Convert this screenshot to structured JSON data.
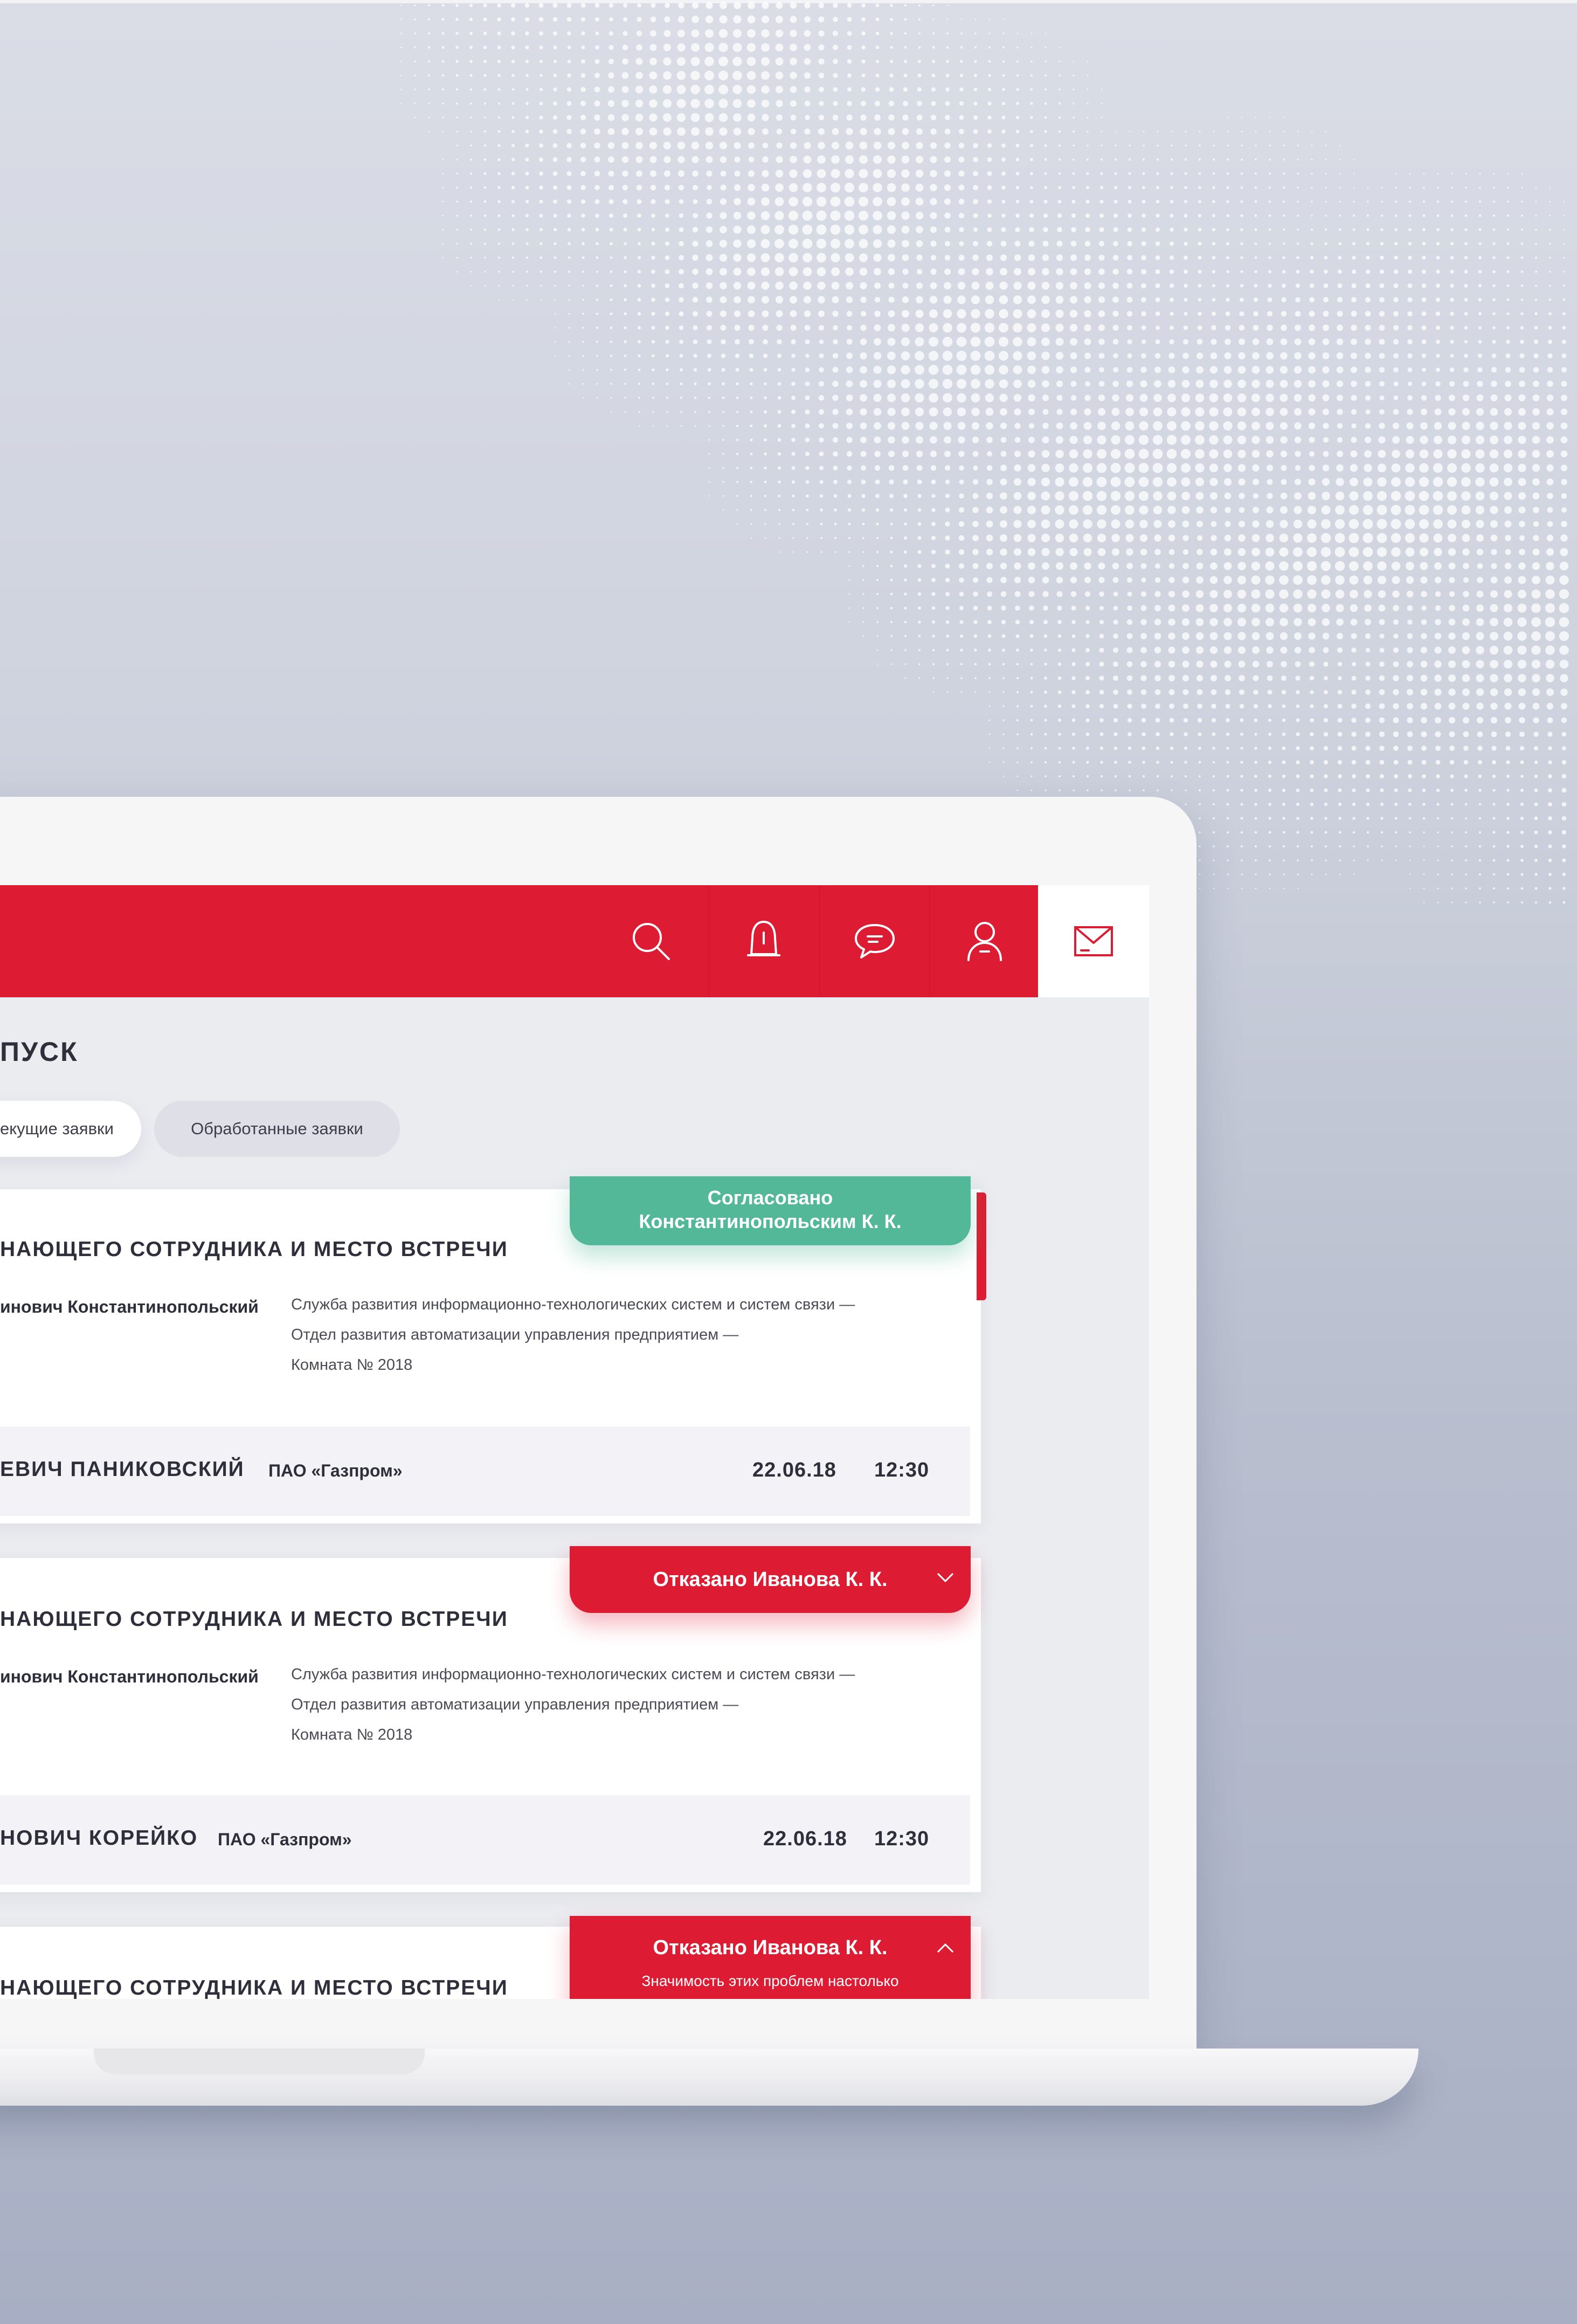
{
  "page": {
    "title_fragment": "ПУСК",
    "tabs": [
      {
        "label": "екущие заявки",
        "active": true
      },
      {
        "label": "Обработанные заявки",
        "active": false
      }
    ]
  },
  "header": {
    "icons": [
      "search-icon",
      "bell-icon",
      "chat-icon",
      "user-icon",
      "mail-icon"
    ],
    "accent_color": "#dd1c33"
  },
  "cards": [
    {
      "title": "НАЮЩЕГО СОТРУДНИКА И МЕСТО ВСТРЕЧИ",
      "employee": "инович Константинопольский",
      "dept_lines": [
        "Служба развития информационно-технологических систем и систем связи —",
        "Отдел развития автоматизации управления предприятием —",
        "Комната № 2018"
      ],
      "visitor": "ЕВИЧ ПАНИКОВСКИЙ",
      "company": "ПАО «Газпром»",
      "date": "22.06.18",
      "time": "12:30",
      "status": {
        "kind": "approved",
        "line1": "Согласовано",
        "line2": "Константинопольским К. К.",
        "color": "#52b898"
      }
    },
    {
      "title": "НАЮЩЕГО СОТРУДНИКА И МЕСТО ВСТРЕЧИ",
      "employee": "инович Константинопольский",
      "dept_lines": [
        "Служба развития информационно-технологических систем и систем связи —",
        "Отдел развития автоматизации управления предприятием —",
        "Комната № 2018"
      ],
      "visitor": "НОВИЧ КОРЕЙКО",
      "company": "ПАО «Газпром»",
      "date": "22.06.18",
      "time": "12:30",
      "status": {
        "kind": "rejected",
        "line1": "Отказано Иванова К. К.",
        "chevron": "chevron-down-icon",
        "color": "#dd1c33"
      }
    },
    {
      "title": "НАЮЩЕГО СОТРУДНИКА И МЕСТО ВСТРЕЧИ",
      "status": {
        "kind": "rejected",
        "line1": "Отказано Иванова К. К.",
        "note": "Значимость этих проблем настолько",
        "chevron": "chevron-up-icon",
        "color": "#dd1c33"
      }
    }
  ]
}
